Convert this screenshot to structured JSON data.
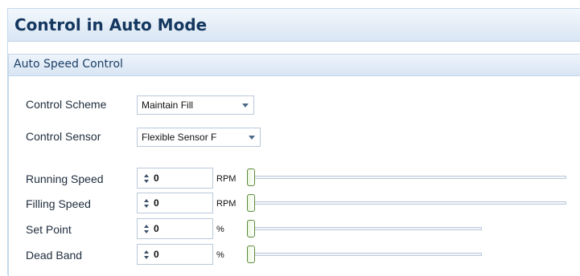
{
  "page": {
    "title": "Control in Auto Mode"
  },
  "group": {
    "title": "Auto Speed Control"
  },
  "control_scheme": {
    "label": "Control Scheme",
    "value": "Maintain Fill"
  },
  "control_sensor": {
    "label": "Control Sensor",
    "value": "Flexible Sensor F"
  },
  "rows": [
    {
      "label": "Running Speed",
      "value": "0",
      "unit": "RPM",
      "slider_fraction": 0
    },
    {
      "label": "Filling Speed",
      "value": "0",
      "unit": "RPM",
      "slider_fraction": 0
    },
    {
      "label": "Set Point",
      "value": "0",
      "unit": "%",
      "slider_fraction": 0
    },
    {
      "label": "Dead Band",
      "value": "0",
      "unit": "%",
      "slider_fraction": 0
    }
  ],
  "colors": {
    "title": "#14375f",
    "header_bg": "#d9e6f4",
    "thumb_border": "#5c8a3a"
  }
}
